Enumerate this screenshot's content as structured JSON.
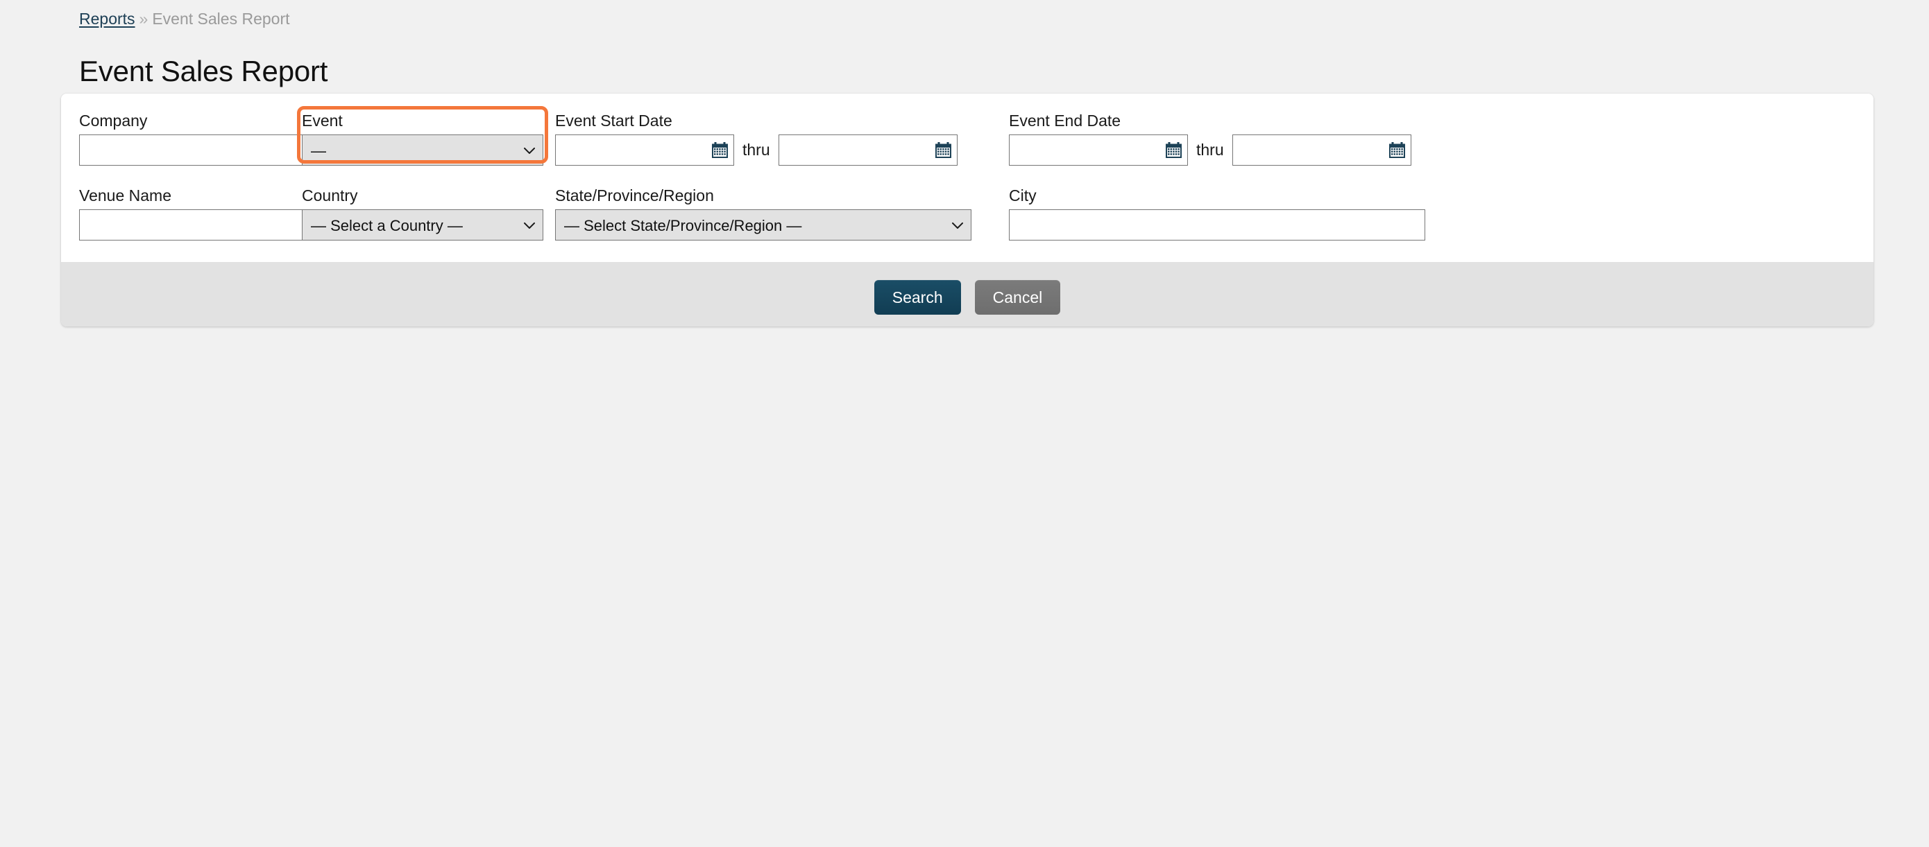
{
  "breadcrumb": {
    "link_label": "Reports",
    "separator": "»",
    "current_label": "Event Sales Report"
  },
  "page": {
    "title": "Event Sales Report"
  },
  "colors": {
    "page_background": "#f1f1f1",
    "panel_background": "#ffffff",
    "footer_background": "#e2e2e2",
    "focus_ring": "#f4773b",
    "primary_button": "#14455c",
    "secondary_button": "#757575",
    "link": "#1d3f55",
    "calendar_icon": "#1d4257"
  },
  "form": {
    "company": {
      "label": "Company",
      "value": "",
      "placeholder": ""
    },
    "event": {
      "label": "Event",
      "value": "—",
      "focused": true,
      "chevron_icon": "chevron-down-icon"
    },
    "event_start_date": {
      "label": "Event Start Date",
      "from_value": "",
      "from_placeholder": "",
      "thru_label": "thru",
      "to_value": "",
      "to_placeholder": "",
      "icon": "calendar-icon"
    },
    "event_end_date": {
      "label": "Event End Date",
      "from_value": "",
      "from_placeholder": "",
      "thru_label": "thru",
      "to_value": "",
      "to_placeholder": "",
      "icon": "calendar-icon"
    },
    "venue_name": {
      "label": "Venue Name",
      "value": "",
      "placeholder": ""
    },
    "country": {
      "label": "Country",
      "value": "— Select a Country —",
      "chevron_icon": "chevron-down-icon"
    },
    "state_province_region": {
      "label": "State/Province/Region",
      "value": "— Select State/Province/Region —",
      "chevron_icon": "chevron-down-icon"
    },
    "city": {
      "label": "City",
      "value": "",
      "placeholder": ""
    }
  },
  "actions": {
    "search_label": "Search",
    "cancel_label": "Cancel"
  }
}
